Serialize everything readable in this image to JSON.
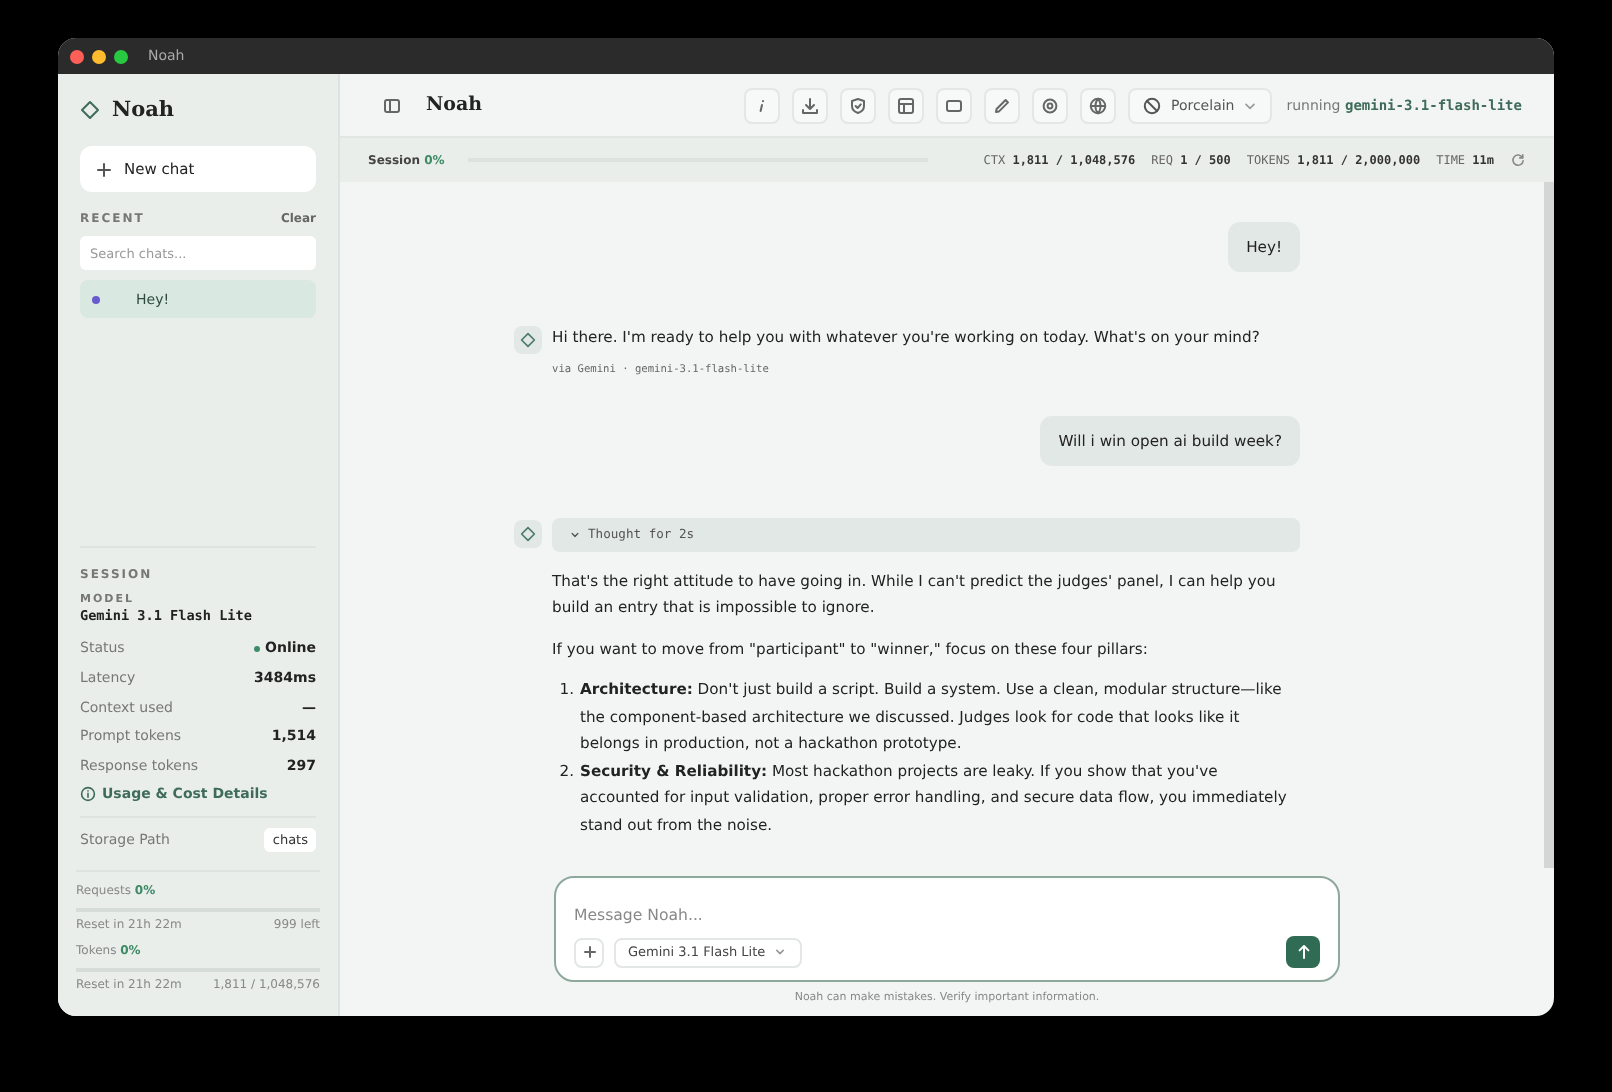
{
  "window": {
    "title": "Noah"
  },
  "sidebar": {
    "brand": "Noah",
    "new_chat": "New chat",
    "recent_label": "RECENT",
    "clear": "Clear",
    "search": {
      "placeholder": "Search chats..."
    },
    "chats": [
      {
        "title": "Hey!",
        "selected": true,
        "color": "#6a5acd"
      }
    ],
    "session": {
      "heading": "SESSION",
      "model_label": "MODEL",
      "model": "Gemini 3.1 Flash Lite",
      "rows": [
        {
          "label": "Status",
          "value": "Online",
          "kind": "status"
        },
        {
          "label": "Latency",
          "value": "3484ms",
          "kind": "plain"
        },
        {
          "label": "Context used",
          "value": "—",
          "kind": "plain"
        },
        {
          "label": "Prompt tokens",
          "value": "1,514",
          "kind": "plain"
        },
        {
          "label": "Response tokens",
          "value": "297",
          "kind": "plain"
        }
      ],
      "details_link": "Usage & Cost Details",
      "storage": {
        "label": "Storage Path",
        "value": "chats"
      }
    },
    "quotas": [
      {
        "label": "Requests",
        "percent": "0%",
        "level": 0,
        "reset": "Reset in 21h 22m",
        "remaining": "999 left"
      },
      {
        "label": "Tokens",
        "percent": "0%",
        "level": 0,
        "reset": "Reset in 21h 22m",
        "remaining": "1,811 / 1,048,576"
      }
    ]
  },
  "header": {
    "title": "Noah",
    "theme": "Porcelain",
    "running_label": "running",
    "running_model": "gemini-3.1-flash-lite"
  },
  "stats": {
    "session_label": "Session",
    "session_percent": "0%",
    "level": 0,
    "items": [
      {
        "label": "CTX",
        "value": "1,811 / 1,048,576"
      },
      {
        "label": "REQ",
        "value": "1 / 500"
      },
      {
        "label": "TOKENS",
        "value": "1,811 / 2,000,000"
      },
      {
        "label": "TIME",
        "value": "11m"
      }
    ]
  },
  "messages": [
    {
      "kind": "user",
      "text": "Hey!"
    },
    {
      "kind": "assistant",
      "paragraphs": [
        "Hi there. I'm ready to help you with whatever you're working on today. What's on your mind?"
      ],
      "meta": "via Gemini · gemini-3.1-flash-lite"
    },
    {
      "kind": "user",
      "text": "Will i win open ai build week?"
    },
    {
      "kind": "assistant",
      "thought": "Thought for 2s",
      "paragraphs": [
        "That's the right attitude to have going in. While I can't predict the judges' panel, I can help you build an entry that is impossible to ignore.",
        "If you want to move from \"participant\" to \"winner,\" focus on these four pillars:"
      ],
      "list": [
        {
          "number": "1.",
          "text": "**Architecture:** Don't just build a script. Build a system. Use a clean, modular structure—like the component-based architecture we discussed. Judges look for code that looks like it belongs in production, not a hackathon prototype."
        },
        {
          "number": "2.",
          "text": "**Security & Reliability:** Most hackathon projects are leaky. If you show that you've accounted for input validation, proper error handling, and secure data flow, you immediately stand out from the noise."
        }
      ]
    }
  ],
  "composer": {
    "placeholder": "Message Noah...",
    "model": "Gemini 3.1 Flash Lite",
    "disclaimer": "Noah can make mistakes. Verify important information."
  }
}
